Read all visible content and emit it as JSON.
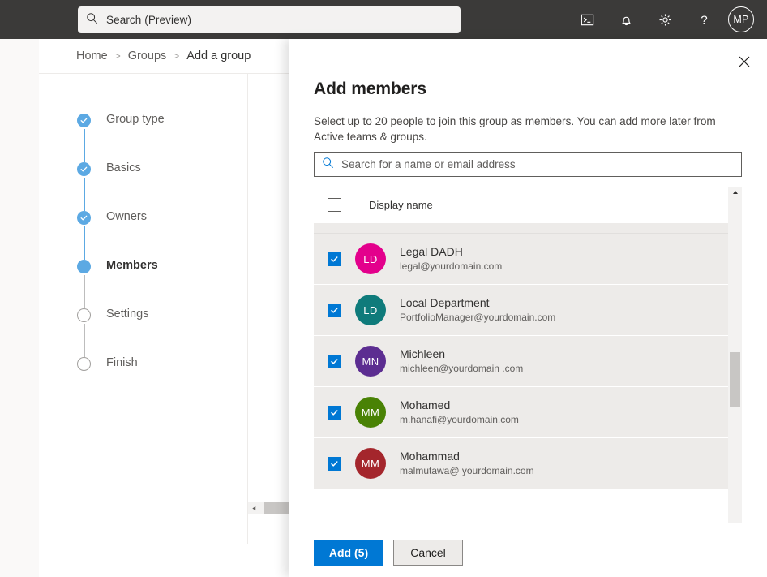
{
  "topbar": {
    "background": "#3b3a39",
    "search": {
      "placeholder": "Search (Preview)",
      "icon": "search-icon"
    },
    "icons": [
      {
        "name": "cloud-shell-icon",
        "title": "Cloud Shell"
      },
      {
        "name": "notifications-bell-icon",
        "title": "Notifications"
      },
      {
        "name": "settings-gear-icon",
        "title": "Settings"
      },
      {
        "name": "help-question-icon",
        "title": "Help"
      }
    ],
    "avatar": {
      "initials": "MP"
    }
  },
  "breadcrumb": {
    "items": [
      {
        "label": "Home"
      },
      {
        "label": "Groups"
      },
      {
        "label": "Add a group"
      }
    ],
    "separator": ">"
  },
  "wizard": {
    "steps": [
      {
        "label": "Group type",
        "state": "done"
      },
      {
        "label": "Basics",
        "state": "done"
      },
      {
        "label": "Owners",
        "state": "done"
      },
      {
        "label": "Members",
        "state": "current"
      },
      {
        "label": "Settings",
        "state": "todo"
      },
      {
        "label": "Finish",
        "state": "todo"
      }
    ],
    "accent": "#5ca9e3"
  },
  "panel": {
    "title": "Add members",
    "description": "Select up to 20 people to join this group as members. You can add more later from Active teams & groups.",
    "close_icon": "close-icon",
    "search": {
      "placeholder": "Search for a name or email address",
      "value": "",
      "icon": "search-icon"
    },
    "list": {
      "header": {
        "label": "Display name",
        "select_all_checked": false
      },
      "rows": [
        {
          "name": "Legal DADH",
          "email": "legal@yourdomain.com",
          "initials": "LD",
          "avatar_color": "#e3008c",
          "checked": true
        },
        {
          "name": "Local Department",
          "email": "PortfolioManager@yourdomain.com",
          "initials": "LD",
          "avatar_color": "#0f7b7b",
          "checked": true
        },
        {
          "name": "Michleen",
          "email": "michleen@yourdomain .com",
          "initials": "MN",
          "avatar_color": "#5c2d91",
          "checked": true
        },
        {
          "name": "Mohamed",
          "email": "m.hanafi@yourdomain.com",
          "initials": "MM",
          "avatar_color": "#498205",
          "checked": true
        },
        {
          "name": "Mohammad",
          "email": "malmutawa@ yourdomain.com",
          "initials": "MM",
          "avatar_color": "#a4262c",
          "checked": true
        }
      ]
    },
    "footer": {
      "primary_label": "Add (5)",
      "secondary_label": "Cancel",
      "primary_color": "#0078d4"
    }
  }
}
